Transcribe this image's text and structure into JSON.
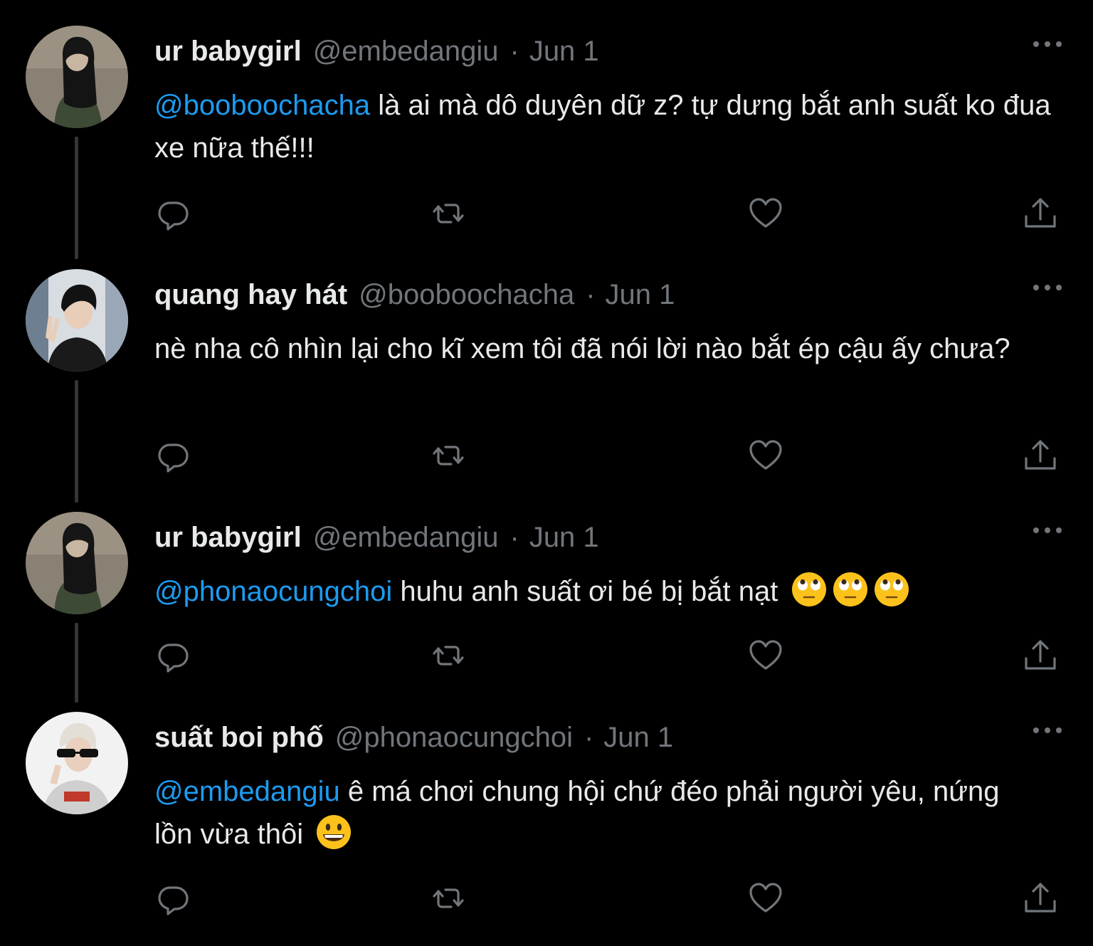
{
  "theme": {
    "background": "#000000",
    "text": "#e7e9ea",
    "muted": "#71767b",
    "accent": "#1d9bf0",
    "thread_line": "#333639"
  },
  "tweets": [
    {
      "display_name": "ur babygirl",
      "handle": "@embedangiu",
      "separator": "·",
      "date": "Jun 1",
      "mention": "@booboochacha",
      "text": " là ai mà dô duyên dữ z? tự dưng bắt anh suất ko đua xe nữa thế!!!",
      "avatar": "avatar-girl-dark-hair",
      "emojis": []
    },
    {
      "display_name": "quang hay hát",
      "handle": "@booboochacha",
      "separator": "·",
      "date": "Jun 1",
      "mention": "",
      "text": "nè nha cô nhìn lại cho kĩ xem tôi đã nói lời nào bắt ép cậu ấy chưa?",
      "avatar": "avatar-boy-peace-sign",
      "emojis": []
    },
    {
      "display_name": "ur babygirl",
      "handle": "@embedangiu",
      "separator": "·",
      "date": "Jun 1",
      "mention": "@phonaocungchoi",
      "text": " huhu anh suất ơi bé bị bắt nạt ",
      "avatar": "avatar-girl-dark-hair",
      "emojis": [
        "rolling-eyes",
        "rolling-eyes",
        "rolling-eyes"
      ]
    },
    {
      "display_name": "suất boi phố",
      "handle": "@phonaocungchoi",
      "separator": "·",
      "date": "Jun 1",
      "mention": "@embedangiu",
      "text": " ê má chơi chung hội chứ đéo phải người yêu, nứng lồn vừa thôi ",
      "avatar": "avatar-boy-sunglasses",
      "emojis": [
        "grinning-face"
      ]
    }
  ],
  "icons": {
    "reply": "reply-icon",
    "retweet": "retweet-icon",
    "like": "like-icon",
    "share": "share-icon",
    "more": "more-icon"
  }
}
